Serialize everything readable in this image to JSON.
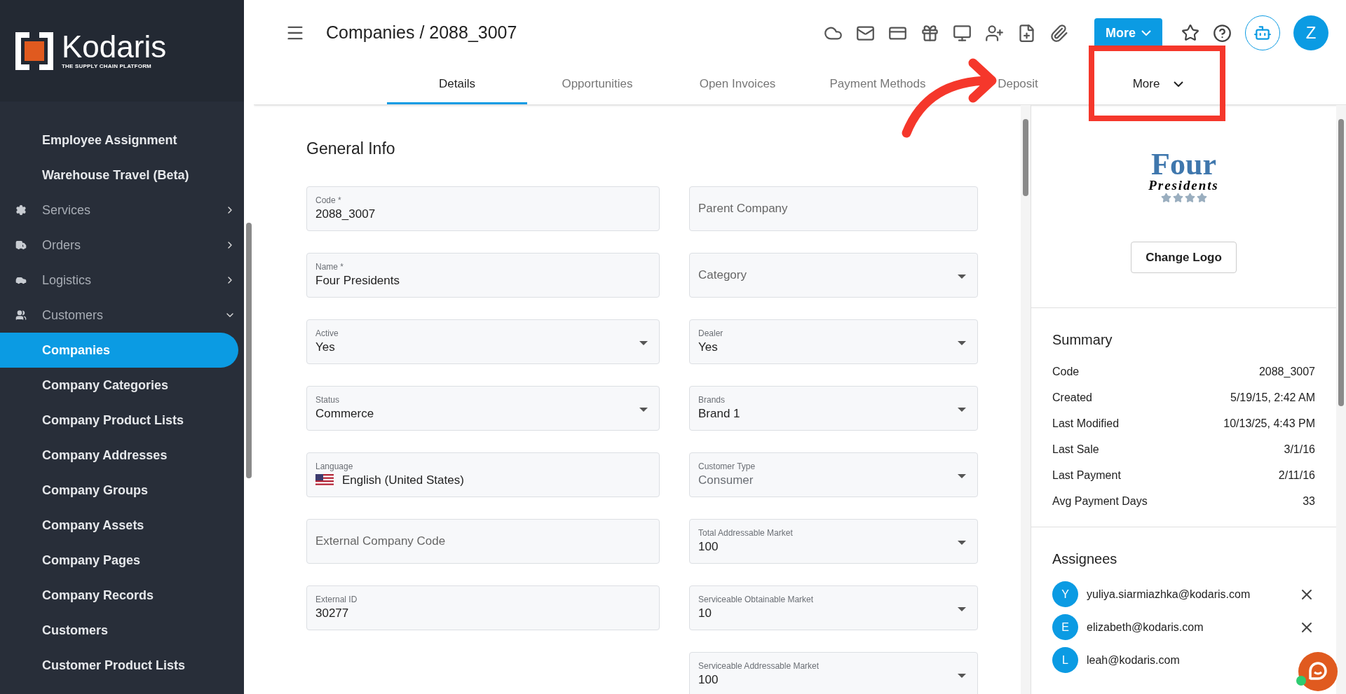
{
  "brand": {
    "name": "Kodaris",
    "tagline": "THE SUPPLY CHAIN PLATFORM"
  },
  "sidebar": {
    "items": [
      {
        "kind": "sub",
        "label": "Employee Assignment",
        "selected": false
      },
      {
        "kind": "sub",
        "label": "Warehouse Travel (Beta)",
        "selected": false
      },
      {
        "kind": "section",
        "label": "Services",
        "expanded": false
      },
      {
        "kind": "section",
        "label": "Orders",
        "expanded": false
      },
      {
        "kind": "section",
        "label": "Logistics",
        "expanded": false
      },
      {
        "kind": "section",
        "label": "Customers",
        "expanded": true
      },
      {
        "kind": "sub",
        "label": "Companies",
        "selected": true
      },
      {
        "kind": "sub",
        "label": "Company Categories",
        "selected": false
      },
      {
        "kind": "sub",
        "label": "Company Product Lists",
        "selected": false
      },
      {
        "kind": "sub",
        "label": "Company Addresses",
        "selected": false
      },
      {
        "kind": "sub",
        "label": "Company Groups",
        "selected": false
      },
      {
        "kind": "sub",
        "label": "Company Assets",
        "selected": false
      },
      {
        "kind": "sub",
        "label": "Company Pages",
        "selected": false
      },
      {
        "kind": "sub",
        "label": "Company Records",
        "selected": false
      },
      {
        "kind": "sub",
        "label": "Customers",
        "selected": false
      },
      {
        "kind": "sub",
        "label": "Customer Product Lists",
        "selected": false
      }
    ]
  },
  "header": {
    "title": "Companies / 2088_3007",
    "more_button": "More",
    "avatar": "Z"
  },
  "tabs": [
    {
      "label": "Details",
      "selected": true
    },
    {
      "label": "Opportunities",
      "selected": false
    },
    {
      "label": "Open Invoices",
      "selected": false
    },
    {
      "label": "Payment Methods",
      "selected": false
    },
    {
      "label": "Deposit",
      "selected": false
    },
    {
      "label": "More",
      "selected": false,
      "dropdown": true
    }
  ],
  "form": {
    "title": "General Info",
    "left": [
      {
        "label": "Code *",
        "value": "2088_3007"
      },
      {
        "label": "Name *",
        "value": "Four Presidents"
      },
      {
        "label": "Active",
        "value": "Yes",
        "dropdown": true
      },
      {
        "label": "Status",
        "value": "Commerce",
        "dropdown": true
      },
      {
        "label": "Language",
        "value": "English (United States)",
        "flag": true
      },
      {
        "placeholder": "External Company Code"
      },
      {
        "label": "External ID",
        "value": "30277"
      }
    ],
    "right": [
      {
        "placeholder": "Parent Company"
      },
      {
        "placeholder": "Category",
        "dropdown": true
      },
      {
        "label": "Dealer",
        "value": "Yes",
        "dropdown": true
      },
      {
        "label": "Brands",
        "value": "Brand 1",
        "dropdown": true
      },
      {
        "label": "Customer Type",
        "value": "Consumer",
        "dropdown": true,
        "disabled": true
      },
      {
        "label": "Total Addressable Market",
        "value": "100",
        "dropdown": true
      },
      {
        "label": "Serviceable Obtainable Market",
        "value": "10",
        "dropdown": true
      },
      {
        "label": "Serviceable Addressable Market",
        "value": "100",
        "dropdown": true
      }
    ]
  },
  "logo": {
    "line1": "Four",
    "line2": "Presidents",
    "stars": 4
  },
  "change_logo": "Change Logo",
  "summary": {
    "title": "Summary",
    "rows": [
      {
        "label": "Code",
        "value": "2088_3007"
      },
      {
        "label": "Created",
        "value": "5/19/15, 2:42 AM"
      },
      {
        "label": "Last Modified",
        "value": "10/13/25, 4:43 PM"
      },
      {
        "label": "Last Sale",
        "value": "3/1/16"
      },
      {
        "label": "Last Payment",
        "value": "2/11/16"
      },
      {
        "label": "Avg Payment Days",
        "value": "33"
      }
    ]
  },
  "assignees": {
    "title": "Assignees",
    "items": [
      {
        "initial": "Y",
        "email": "yuliya.siarmiazhka@kodaris.com"
      },
      {
        "initial": "E",
        "email": "elizabeth@kodaris.com"
      },
      {
        "initial": "L",
        "email": "leah@kodaris.com"
      }
    ]
  }
}
